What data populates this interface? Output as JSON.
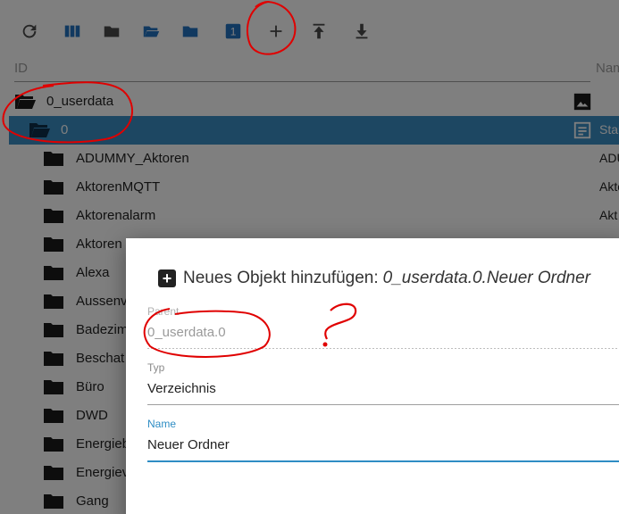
{
  "toolbar": {
    "buttons": [
      {
        "icon": "refresh-icon"
      },
      {
        "icon": "columns-icon"
      },
      {
        "icon": "folder-icon"
      },
      {
        "icon": "folder-open-icon"
      },
      {
        "icon": "folder-icon"
      },
      {
        "icon": "badge-1-icon",
        "badge": "1"
      },
      {
        "icon": "plus-icon"
      },
      {
        "icon": "upload-icon"
      },
      {
        "icon": "download-icon"
      }
    ]
  },
  "columns": {
    "id": "ID",
    "name": "Nam"
  },
  "tree": [
    {
      "label": "0_userdata",
      "name": "",
      "open": true,
      "right_icon": "image-icon"
    },
    {
      "label": "0",
      "name": "Star",
      "open": true,
      "selected": true,
      "right_icon": "document-icon"
    },
    {
      "label": "ADUMMY_Aktoren",
      "name": "ADU"
    },
    {
      "label": "AktorenMQTT",
      "name": "Akto"
    },
    {
      "label": "Aktorenalarm",
      "name": "Akt"
    },
    {
      "label": "Aktoren",
      "name": ""
    },
    {
      "label": "Alexa",
      "name": ""
    },
    {
      "label": "Aussenv",
      "name": ""
    },
    {
      "label": "Badezim",
      "name": ""
    },
    {
      "label": "Beschat",
      "name": ""
    },
    {
      "label": "Büro",
      "name": ""
    },
    {
      "label": "DWD",
      "name": ""
    },
    {
      "label": "Energieb",
      "name": ""
    },
    {
      "label": "Energiev",
      "name": ""
    },
    {
      "label": "Gang",
      "name": ""
    }
  ],
  "dialog": {
    "title": "Neues Objekt hinzufügen:",
    "title_path": "0_userdata.0.Neuer Ordner",
    "parent_label": "Parent",
    "parent_value": "0_userdata.0",
    "type_label": "Typ",
    "type_value": "Verzeichnis",
    "name_label": "Name",
    "name_value": "Neuer Ordner"
  },
  "colors": {
    "accent": "#3b8ec4",
    "annotation": "#e00000"
  }
}
